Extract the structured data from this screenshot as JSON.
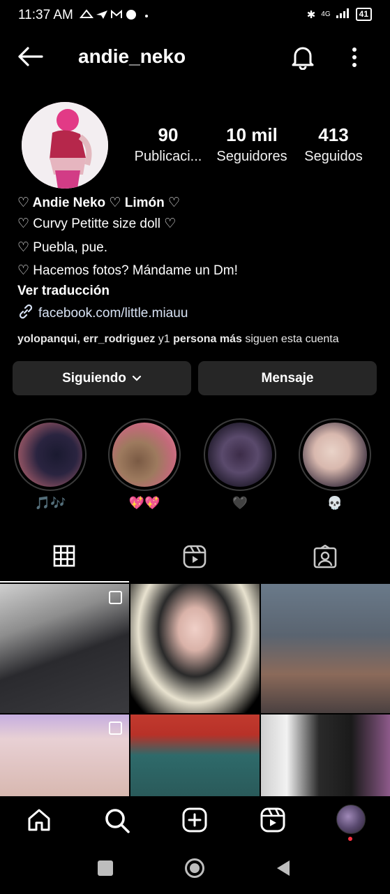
{
  "status_bar": {
    "time": "11:37 AM",
    "network": "4G",
    "battery": "41"
  },
  "header": {
    "username": "andie_neko"
  },
  "profile": {
    "posts_count": "90",
    "posts_label": "Publicaci...",
    "followers_count": "10 mil",
    "followers_label": "Seguidores",
    "following_count": "413",
    "following_label": "Seguidos",
    "bio": [
      "♡ Andie Neko ♡ Limón ♡",
      "♡ Curvy Petitte size doll ♡",
      "♡ Puebla, pue.",
      "♡ Hacemos fotos? Mándame un Dm!"
    ],
    "translate": "Ver traducción",
    "link": "facebook.com/little.miauu",
    "followed_by_users": "yolopanqui, err_rodriguez",
    "followed_by_rest": " y1 ",
    "followed_by_more": "persona más",
    "followed_by_tail": " siguen esta cuenta"
  },
  "actions": {
    "following_button": "Siguiendo",
    "message_button": "Mensaje"
  },
  "highlights": [
    {
      "label": "🎵🎶"
    },
    {
      "label": "💖💖"
    },
    {
      "label": "🖤"
    },
    {
      "label": "💀"
    }
  ],
  "colors": {
    "background": "#000000",
    "button_bg": "#262626",
    "link": "#d8e3f5",
    "notification_dot": "#ff3040"
  }
}
